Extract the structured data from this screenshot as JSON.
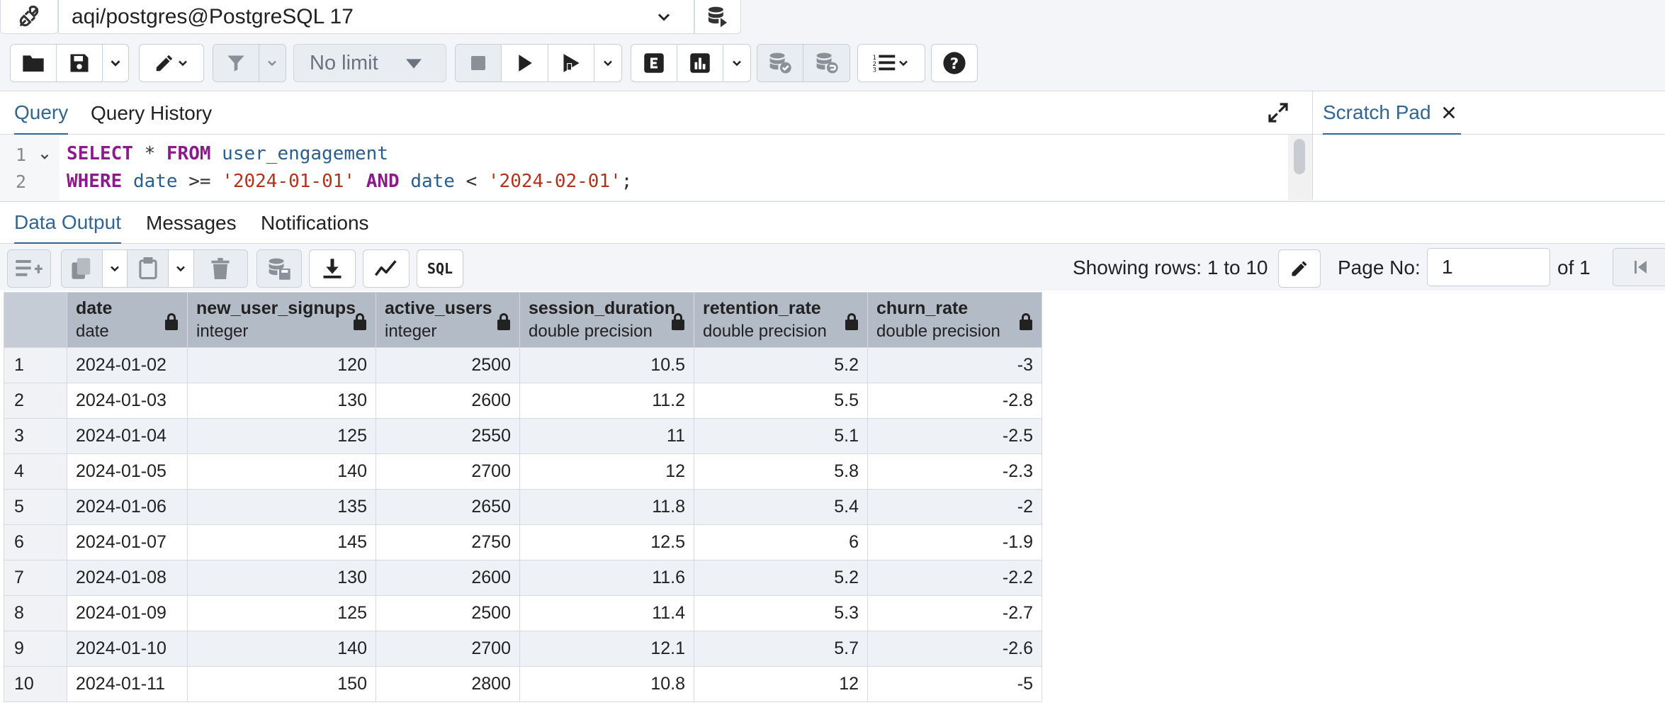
{
  "connection": {
    "label": "aqi/postgres@PostgreSQL 17"
  },
  "toolbar": {
    "limit_label": "No limit"
  },
  "query_tabs": [
    "Query",
    "Query History"
  ],
  "scratch": {
    "title": "Scratch Pad"
  },
  "editor": {
    "lines": [
      {
        "num": "1",
        "tokens": [
          {
            "t": "SELECT",
            "c": "kw"
          },
          {
            "t": " * ",
            "c": "op"
          },
          {
            "t": "FROM",
            "c": "kw"
          },
          {
            "t": " ",
            "c": "op"
          },
          {
            "t": "user_engagement",
            "c": "id"
          }
        ]
      },
      {
        "num": "2",
        "tokens": [
          {
            "t": "WHERE",
            "c": "kw"
          },
          {
            "t": " ",
            "c": "op"
          },
          {
            "t": "date",
            "c": "id"
          },
          {
            "t": " >= ",
            "c": "op"
          },
          {
            "t": "'2024-01-01'",
            "c": "str"
          },
          {
            "t": " ",
            "c": "op"
          },
          {
            "t": "AND",
            "c": "kw"
          },
          {
            "t": " ",
            "c": "op"
          },
          {
            "t": "date",
            "c": "id"
          },
          {
            "t": " < ",
            "c": "op"
          },
          {
            "t": "'2024-02-01'",
            "c": "str"
          },
          {
            "t": ";",
            "c": "op"
          }
        ]
      }
    ]
  },
  "result_tabs": [
    "Data Output",
    "Messages",
    "Notifications"
  ],
  "pagination": {
    "showing": "Showing rows: 1 to 10",
    "page_label": "Page No:",
    "page_value": "1",
    "of_label": "of 1"
  },
  "grid": {
    "columns": [
      {
        "name": "date",
        "type": "date"
      },
      {
        "name": "new_user_signups",
        "type": "integer"
      },
      {
        "name": "active_users",
        "type": "integer"
      },
      {
        "name": "session_duration",
        "type": "double precision"
      },
      {
        "name": "retention_rate",
        "type": "double precision"
      },
      {
        "name": "churn_rate",
        "type": "double precision"
      }
    ],
    "rows": [
      [
        "1",
        "2024-01-02",
        "120",
        "2500",
        "10.5",
        "5.2",
        "-3"
      ],
      [
        "2",
        "2024-01-03",
        "130",
        "2600",
        "11.2",
        "5.5",
        "-2.8"
      ],
      [
        "3",
        "2024-01-04",
        "125",
        "2550",
        "11",
        "5.1",
        "-2.5"
      ],
      [
        "4",
        "2024-01-05",
        "140",
        "2700",
        "12",
        "5.8",
        "-2.3"
      ],
      [
        "5",
        "2024-01-06",
        "135",
        "2650",
        "11.8",
        "5.4",
        "-2"
      ],
      [
        "6",
        "2024-01-07",
        "145",
        "2750",
        "12.5",
        "6",
        "-1.9"
      ],
      [
        "7",
        "2024-01-08",
        "130",
        "2600",
        "11.6",
        "5.2",
        "-2.2"
      ],
      [
        "8",
        "2024-01-09",
        "125",
        "2500",
        "11.4",
        "5.3",
        "-2.7"
      ],
      [
        "9",
        "2024-01-10",
        "140",
        "2700",
        "12.1",
        "5.7",
        "-2.6"
      ],
      [
        "10",
        "2024-01-11",
        "150",
        "2800",
        "10.8",
        "12",
        "-5"
      ]
    ]
  },
  "colors": {
    "accent": "#326690",
    "header_bg": "#b3bbc7"
  }
}
